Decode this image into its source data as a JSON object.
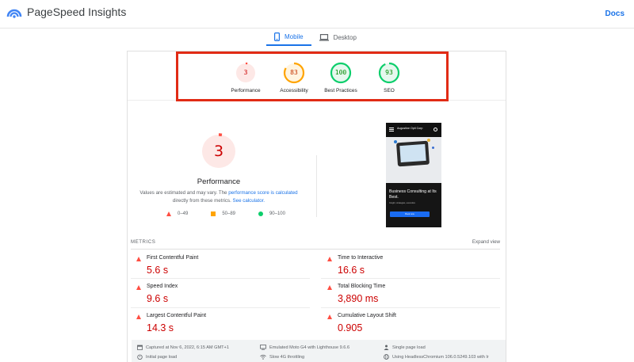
{
  "header": {
    "brand": "PageSpeed Insights",
    "docs_link": "Docs"
  },
  "tabs": [
    {
      "label": "Mobile",
      "icon": "phone-icon",
      "active": true
    },
    {
      "label": "Desktop",
      "icon": "laptop-icon",
      "active": false
    }
  ],
  "scores": [
    {
      "label": "Performance",
      "value": "3",
      "score": 3,
      "color": "#ff4e42"
    },
    {
      "label": "Accessibility",
      "value": "83",
      "score": 83,
      "color": "#ffa400"
    },
    {
      "label": "Best Practices",
      "value": "100",
      "score": 100,
      "color": "#0cce6b"
    },
    {
      "label": "SEO",
      "value": "93",
      "score": 93,
      "color": "#0cce6b"
    }
  ],
  "performance": {
    "score": "3",
    "title": "Performance",
    "note_prefix": "Values are estimated and may vary. The ",
    "note_link1": "performance score is calculated",
    "note_middle": " directly from these metrics. ",
    "note_link2": "See calculator."
  },
  "legend": [
    {
      "range": "0–49",
      "shape": "triangle",
      "color": "#ff4e42"
    },
    {
      "range": "50–89",
      "shape": "square",
      "color": "#ffa400"
    },
    {
      "range": "90–100",
      "shape": "circle",
      "color": "#0cce6b"
    }
  ],
  "screenshot": {
    "site_title": "Augustine Opti Corp",
    "headline": "Business Consulting at Its Best.",
    "subtext": "Insight, strategies, execution.",
    "button": "Book now"
  },
  "metrics": {
    "heading": "METRICS",
    "expand": "Expand view",
    "items": [
      {
        "name": "First Contentful Paint",
        "value": "5.6 s"
      },
      {
        "name": "Time to Interactive",
        "value": "16.6 s"
      },
      {
        "name": "Speed Index",
        "value": "9.6 s"
      },
      {
        "name": "Total Blocking Time",
        "value": "3,890 ms"
      },
      {
        "name": "Largest Contentful Paint",
        "value": "14.3 s"
      },
      {
        "name": "Cumulative Layout Shift",
        "value": "0.905"
      }
    ]
  },
  "info": {
    "captured": "Captured at Nov 6, 2022, 6:15 AM GMT+1",
    "device": "Emulated Moto G4 with Lighthouse 9.6.6",
    "session": "Single page load",
    "load": "Initial page load",
    "throttling": "Slow 4G throttling",
    "browser": "Using HeadlessChromium 106.0.5249.103 with lr"
  },
  "colors": {
    "fail": "#ff4e42",
    "fail_text": "#cc0000",
    "average": "#ffa400",
    "pass": "#0cce6b",
    "accent": "#1a73e8",
    "highlight": "#e12b15"
  }
}
